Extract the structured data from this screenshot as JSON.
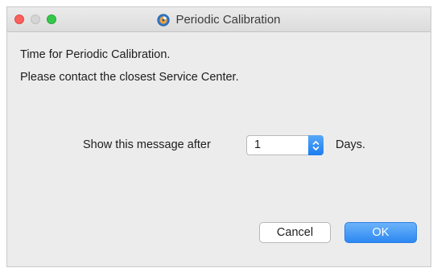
{
  "window": {
    "title": "Periodic Calibration",
    "app_icon": "calibration-app-icon"
  },
  "message": {
    "line1": "Time for Periodic Calibration.",
    "line2": "Please contact the closest Service Center."
  },
  "reminder": {
    "label": "Show this message after",
    "value": "1",
    "suffix": "Days."
  },
  "buttons": {
    "cancel": "Cancel",
    "ok": "OK"
  },
  "colors": {
    "accent": "#2c88f2",
    "close": "#fc605c",
    "zoom": "#34c84a"
  }
}
